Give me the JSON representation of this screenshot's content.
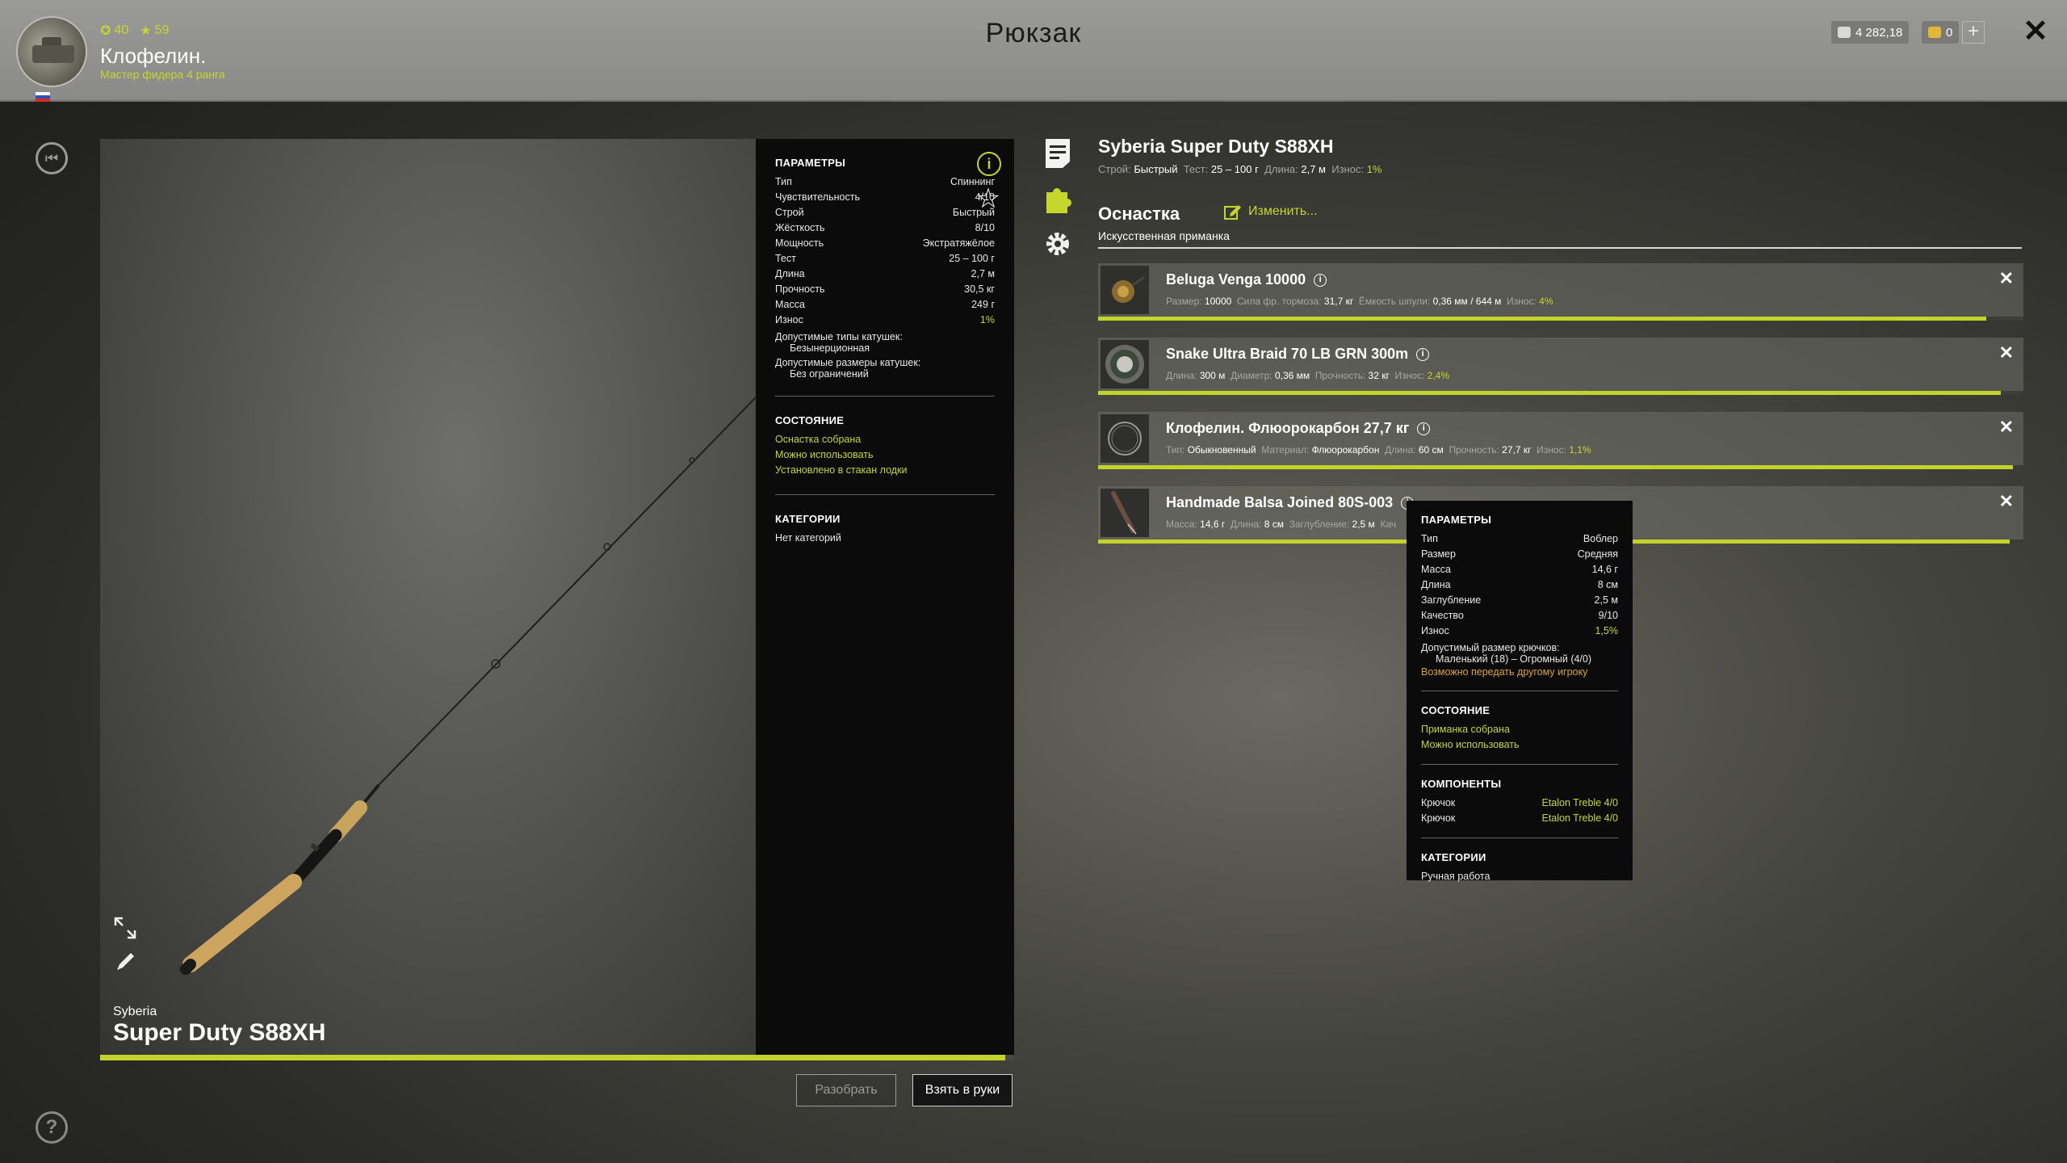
{
  "header": {
    "title": "Рюкзак",
    "stat_a": "40",
    "stat_b": "59",
    "player_name": "Клофелин.",
    "player_rank": "Мастер фидера 4 ранга",
    "money": "4 282,18",
    "gold": "0",
    "add_label": "+",
    "close_label": "✕"
  },
  "rod_view": {
    "brand": "Syberia",
    "model": "Super Duty S88XH",
    "progress_fraction": 0.99
  },
  "params": {
    "title": "ПАРАМЕТРЫ",
    "rows": [
      {
        "label": "Тип",
        "value": "Спиннинг"
      },
      {
        "label": "Чувствительность",
        "value": "4/10"
      },
      {
        "label": "Строй",
        "value": "Быстрый"
      },
      {
        "label": "Жёсткость",
        "value": "8/10"
      },
      {
        "label": "Мощность",
        "value": "Экстратяжёлое"
      },
      {
        "label": "Тест",
        "value": "25 – 100 г"
      },
      {
        "label": "Длина",
        "value": "2,7 м"
      },
      {
        "label": "Прочность",
        "value": "30,5 кг"
      },
      {
        "label": "Масса",
        "value": "249 г"
      },
      {
        "label": "Износ",
        "value": "1%"
      }
    ],
    "reel_types_label": "Допустимые типы катушек:",
    "reel_types_value": "Безынерционная",
    "reel_sizes_label": "Допустимые размеры катушек:",
    "reel_sizes_value": "Без ограничений",
    "state_title": "СОСТОЯНИЕ",
    "state_items": [
      "Оснастка собрана",
      "Можно использовать",
      "Установлено в стакан лодки"
    ],
    "cat_title": "КАТЕГОРИИ",
    "cat_value": "Нет категорий"
  },
  "buttons": {
    "disassemble": "Разобрать",
    "take": "Взять в руки"
  },
  "rod_info": {
    "title": "Syberia Super Duty S88XH",
    "action_label": "Строй:",
    "action_value": "Быстрый",
    "test_label": "Тест:",
    "test_value": "25 – 100 г",
    "length_label": "Длина:",
    "length_value": "2,7 м",
    "wear_label": "Износ:",
    "wear_value": "1%"
  },
  "tackle": {
    "title": "Оснастка",
    "change_label": "Изменить...",
    "subtitle": "Искусственная приманка"
  },
  "items": [
    {
      "name": "Beluga Venga 10000",
      "props": [
        {
          "label": "Размер:",
          "value": "10000"
        },
        {
          "label": "Сила фр. тормоза:",
          "value": "31,7 кг"
        },
        {
          "label": "Ёмкость шпули:",
          "value": "0,36 мм / 644 м"
        },
        {
          "label": "Износ:",
          "value": "4%",
          "hl": true
        }
      ],
      "condition": 0.96
    },
    {
      "name": "Snake Ultra Braid 70 LB GRN 300m",
      "props": [
        {
          "label": "Длина:",
          "value": "300 м"
        },
        {
          "label": "Диаметр:",
          "value": "0,36 мм"
        },
        {
          "label": "Прочность:",
          "value": "32 кг"
        },
        {
          "label": "Износ:",
          "value": "2,4%",
          "hl": true
        }
      ],
      "condition": 0.976
    },
    {
      "name": "Клофелин. Флюорокарбон 27,7 кг",
      "props": [
        {
          "label": "Тип:",
          "value": "Обыкновенный"
        },
        {
          "label": "Материал:",
          "value": "Флюорокарбон"
        },
        {
          "label": "Длина:",
          "value": "60 см"
        },
        {
          "label": "Прочность:",
          "value": "27,7 кг"
        },
        {
          "label": "Износ:",
          "value": "1,1%",
          "hl": true
        }
      ],
      "condition": 0.989
    },
    {
      "name": "Handmade Balsa Joined 80S-003",
      "props": [
        {
          "label": "Масса:",
          "value": "14,6 г"
        },
        {
          "label": "Длина:",
          "value": "8 см"
        },
        {
          "label": "Заглубление:",
          "value": "2,5 м"
        },
        {
          "label": "Кач",
          "value": ""
        }
      ],
      "condition": 0.985
    }
  ],
  "tooltip": {
    "title": "ПАРАМЕТРЫ",
    "rows": [
      {
        "label": "Тип",
        "value": "Воблер"
      },
      {
        "label": "Размер",
        "value": "Средняя"
      },
      {
        "label": "Масса",
        "value": "14,6 г"
      },
      {
        "label": "Длина",
        "value": "8 см"
      },
      {
        "label": "Заглубление",
        "value": "2,5 м"
      },
      {
        "label": "Качество",
        "value": "9/10"
      },
      {
        "label": "Износ",
        "value": "1,5%"
      }
    ],
    "hook_label": "Допустимый размер крючков:",
    "hook_value": "Маленький (18) – Огромный (4/0)",
    "transfer": "Возможно передать другому игроку",
    "state_title": "СОСТОЯНИЕ",
    "state_items": [
      "Приманка собрана",
      "Можно использовать"
    ],
    "comp_title": "КОМПОНЕНТЫ",
    "components": [
      {
        "label": "Крючок",
        "value": "Etalon Treble 4/0"
      },
      {
        "label": "Крючок",
        "value": "Etalon Treble 4/0"
      }
    ],
    "cat_title": "КАТЕГОРИИ",
    "cat_value": "Ручная работа"
  },
  "colors": {
    "accent": "#c6d62c",
    "panel": "#0b0b0b",
    "header": "#9a9a98"
  },
  "icons": [
    "back-icon",
    "help-icon",
    "info-icon",
    "star-icon",
    "expand-icon",
    "edit-icon",
    "document-icon",
    "puzzle-icon",
    "gear-icon",
    "pencil-icon",
    "close-icon",
    "plus-icon"
  ]
}
